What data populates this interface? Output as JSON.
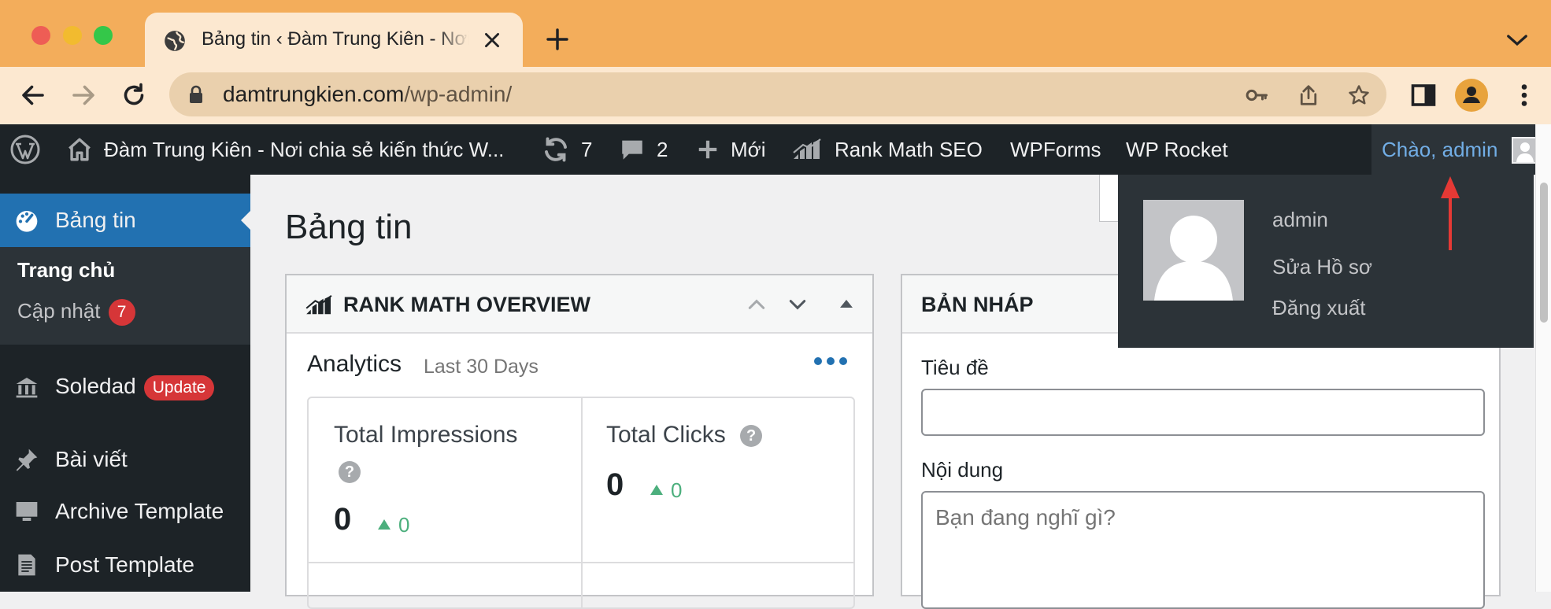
{
  "browser": {
    "tab_title": "Bảng tin ‹ Đàm Trung Kiên - Nơi chia sẻ kiến thức W",
    "url_host": "damtrungkien.com",
    "url_path": "/wp-admin/"
  },
  "adminbar": {
    "site_name": "Đàm Trung Kiên - Nơi chia sẻ kiến thức W...",
    "updates_count": "7",
    "comments_count": "2",
    "new_label": "Mới",
    "rank_math_label": "Rank Math SEO",
    "wpforms_label": "WPForms",
    "wprocket_label": "WP Rocket",
    "greeting": "Chào, admin"
  },
  "account_menu": {
    "username": "admin",
    "edit_profile": "Sửa Hồ sơ",
    "logout": "Đăng xuất"
  },
  "sidebar": {
    "dashboard": "Bảng tin",
    "home": "Trang chủ",
    "updates": "Cập nhật",
    "updates_badge": "7",
    "soledad": "Soledad",
    "soledad_badge": "Update",
    "posts": "Bài viết",
    "archive_template": "Archive Template",
    "post_template": "Post Template"
  },
  "main": {
    "page_title": "Bảng tin",
    "rank_math_box": {
      "title": "RANK MATH OVERVIEW",
      "analytics_title": "Analytics",
      "analytics_period": "Last 30 Days",
      "impressions_label": "Total Impressions",
      "impressions_value": "0",
      "impressions_delta": "0",
      "clicks_label": "Total Clicks",
      "clicks_value": "0",
      "clicks_delta": "0"
    },
    "draft_box": {
      "title": "BẢN NHÁP",
      "title_label": "Tiêu đề",
      "title_value": "",
      "content_label": "Nội dung",
      "content_placeholder": "Bạn đang nghĩ gì?"
    }
  },
  "colors": {
    "tabbar": "#f3ad5b",
    "toolbar": "#fce8d0",
    "wp_dark": "#1d2327",
    "wp_blue": "#2271b1",
    "badge_red": "#d63638",
    "link_blue": "#72aee6"
  }
}
